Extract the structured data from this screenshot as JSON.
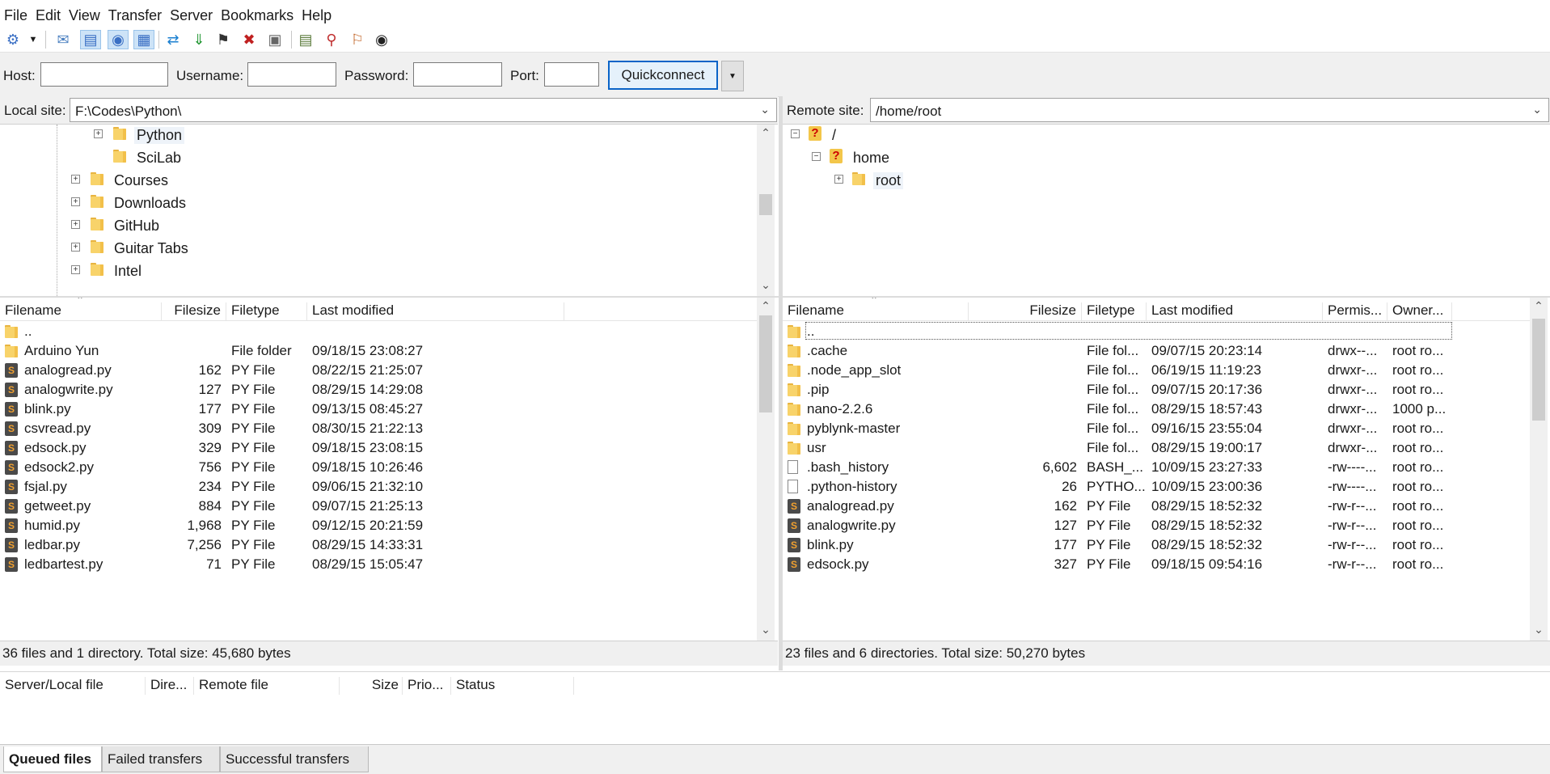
{
  "menu": [
    "File",
    "Edit",
    "View",
    "Transfer",
    "Server",
    "Bookmarks",
    "Help"
  ],
  "quickconnect": {
    "host_label": "Host:",
    "username_label": "Username:",
    "password_label": "Password:",
    "port_label": "Port:",
    "host_value": "",
    "username_value": "",
    "password_value": "",
    "port_value": "",
    "button_label": "Quickconnect"
  },
  "local": {
    "site_label": "Local site:",
    "path": "F:\\Codes\\Python\\",
    "tree": [
      "Python",
      "SciLab",
      "Courses",
      "Downloads",
      "GitHub",
      "Guitar Tabs",
      "Intel"
    ],
    "columns": [
      "Filename",
      "Filesize",
      "Filetype",
      "Last modified"
    ],
    "parent": "..",
    "files": [
      {
        "name": "Arduino Yun",
        "size": "",
        "type": "File folder",
        "modified": "09/18/15 23:08:27",
        "kind": "folder"
      },
      {
        "name": "analogread.py",
        "size": "162",
        "type": "PY File",
        "modified": "08/22/15 21:25:07",
        "kind": "py"
      },
      {
        "name": "analogwrite.py",
        "size": "127",
        "type": "PY File",
        "modified": "08/29/15 14:29:08",
        "kind": "py"
      },
      {
        "name": "blink.py",
        "size": "177",
        "type": "PY File",
        "modified": "09/13/15 08:45:27",
        "kind": "py"
      },
      {
        "name": "csvread.py",
        "size": "309",
        "type": "PY File",
        "modified": "08/30/15 21:22:13",
        "kind": "py"
      },
      {
        "name": "edsock.py",
        "size": "329",
        "type": "PY File",
        "modified": "09/18/15 23:08:15",
        "kind": "py"
      },
      {
        "name": "edsock2.py",
        "size": "756",
        "type": "PY File",
        "modified": "09/18/15 10:26:46",
        "kind": "py"
      },
      {
        "name": "fsjal.py",
        "size": "234",
        "type": "PY File",
        "modified": "09/06/15 21:32:10",
        "kind": "py"
      },
      {
        "name": "getweet.py",
        "size": "884",
        "type": "PY File",
        "modified": "09/07/15 21:25:13",
        "kind": "py"
      },
      {
        "name": "humid.py",
        "size": "1,968",
        "type": "PY File",
        "modified": "09/12/15 20:21:59",
        "kind": "py"
      },
      {
        "name": "ledbar.py",
        "size": "7,256",
        "type": "PY File",
        "modified": "08/29/15 14:33:31",
        "kind": "py"
      },
      {
        "name": "ledbartest.py",
        "size": "71",
        "type": "PY File",
        "modified": "08/29/15 15:05:47",
        "kind": "py"
      }
    ],
    "status": "36 files and 1 directory. Total size: 45,680 bytes"
  },
  "remote": {
    "site_label": "Remote site:",
    "path": "/home/root",
    "tree": [
      "/",
      "home",
      "root"
    ],
    "columns": [
      "Filename",
      "Filesize",
      "Filetype",
      "Last modified",
      "Permis...",
      "Owner..."
    ],
    "parent": "..",
    "files": [
      {
        "name": ".cache",
        "size": "",
        "type": "File fol...",
        "modified": "09/07/15 20:23:14",
        "perm": "drwx--...",
        "owner": "root ro...",
        "kind": "folder"
      },
      {
        "name": ".node_app_slot",
        "size": "",
        "type": "File fol...",
        "modified": "06/19/15 11:19:23",
        "perm": "drwxr-...",
        "owner": "root ro...",
        "kind": "folder"
      },
      {
        "name": ".pip",
        "size": "",
        "type": "File fol...",
        "modified": "09/07/15 20:17:36",
        "perm": "drwxr-...",
        "owner": "root ro...",
        "kind": "folder"
      },
      {
        "name": "nano-2.2.6",
        "size": "",
        "type": "File fol...",
        "modified": "08/29/15 18:57:43",
        "perm": "drwxr-...",
        "owner": "1000 p...",
        "kind": "folder"
      },
      {
        "name": "pyblynk-master",
        "size": "",
        "type": "File fol...",
        "modified": "09/16/15 23:55:04",
        "perm": "drwxr-...",
        "owner": "root ro...",
        "kind": "folder"
      },
      {
        "name": "usr",
        "size": "",
        "type": "File fol...",
        "modified": "08/29/15 19:00:17",
        "perm": "drwxr-...",
        "owner": "root ro...",
        "kind": "folder"
      },
      {
        "name": ".bash_history",
        "size": "6,602",
        "type": "BASH_...",
        "modified": "10/09/15 23:27:33",
        "perm": "-rw----...",
        "owner": "root ro...",
        "kind": "doc"
      },
      {
        "name": ".python-history",
        "size": "26",
        "type": "PYTHO...",
        "modified": "10/09/15 23:00:36",
        "perm": "-rw----...",
        "owner": "root ro...",
        "kind": "doc"
      },
      {
        "name": "analogread.py",
        "size": "162",
        "type": "PY File",
        "modified": "08/29/15 18:52:32",
        "perm": "-rw-r--...",
        "owner": "root ro...",
        "kind": "py"
      },
      {
        "name": "analogwrite.py",
        "size": "127",
        "type": "PY File",
        "modified": "08/29/15 18:52:32",
        "perm": "-rw-r--...",
        "owner": "root ro...",
        "kind": "py"
      },
      {
        "name": "blink.py",
        "size": "177",
        "type": "PY File",
        "modified": "08/29/15 18:52:32",
        "perm": "-rw-r--...",
        "owner": "root ro...",
        "kind": "py"
      },
      {
        "name": "edsock.py",
        "size": "327",
        "type": "PY File",
        "modified": "09/18/15 09:54:16",
        "perm": "-rw-r--...",
        "owner": "root ro...",
        "kind": "py"
      }
    ],
    "status": "23 files and 6 directories. Total size: 50,270 bytes"
  },
  "queue": {
    "columns": [
      "Server/Local file",
      "Dire...",
      "Remote file",
      "Size",
      "Prio...",
      "Status"
    ],
    "tabs": [
      "Queued files",
      "Failed transfers",
      "Successful transfers"
    ]
  },
  "icons": {
    "toolbar": [
      "site-manager-icon",
      "dropdown-icon",
      "message-log-icon",
      "local-tree-icon",
      "remote-tree-icon",
      "queue-icon",
      "refresh-icon",
      "process-queue-icon",
      "cancel-icon",
      "disconnect-icon",
      "reconnect-icon",
      "filter-icon",
      "compare-icon",
      "sync-browse-icon",
      "search-icon"
    ]
  }
}
